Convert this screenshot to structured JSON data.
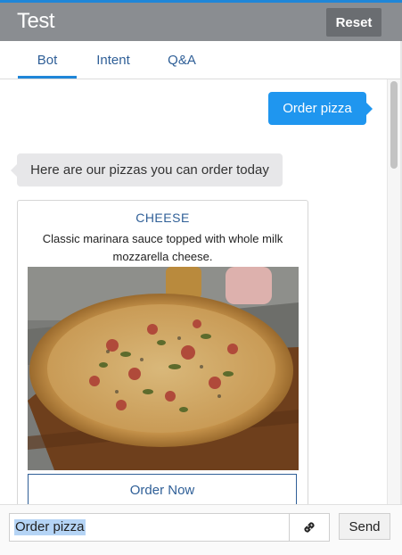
{
  "header": {
    "title": "Test",
    "reset_label": "Reset"
  },
  "tabs": [
    {
      "label": "Bot",
      "active": true
    },
    {
      "label": "Intent",
      "active": false
    },
    {
      "label": "Q&A",
      "active": false
    }
  ],
  "conversation": {
    "user_message": "Order pizza",
    "bot_message": "Here are our pizzas you can order today",
    "card": {
      "title": "CHEESE",
      "description": "Classic marinara sauce topped with whole milk mozzarella cheese.",
      "image": "pizza-photo",
      "button_label": "Order Now"
    }
  },
  "composer": {
    "input_value": "Order pizza",
    "attach_icon": "link-icon",
    "send_label": "Send"
  },
  "colors": {
    "accent": "#1f86d8",
    "user_bubble": "#1f96ef",
    "bot_bubble": "#e7e7e9",
    "header_bg": "#8a8d91",
    "link_text": "#2f5f97"
  }
}
